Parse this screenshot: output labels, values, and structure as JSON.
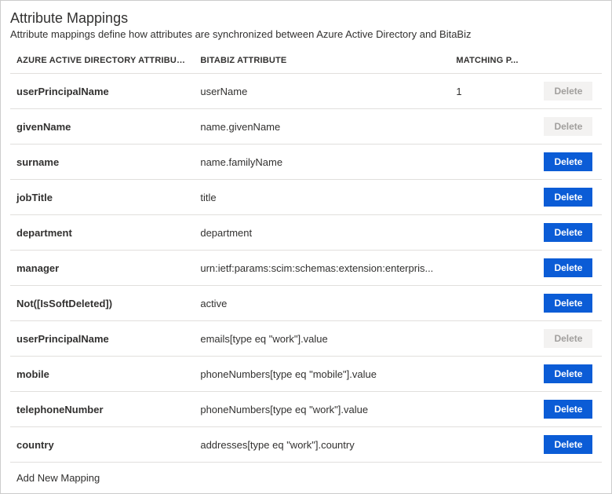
{
  "header": {
    "title": "Attribute Mappings",
    "description": "Attribute mappings define how attributes are synchronized between Azure Active Directory and BitaBiz"
  },
  "table": {
    "columns": {
      "azure": "AZURE ACTIVE DIRECTORY ATTRIBUTE",
      "target": "BITABIZ ATTRIBUTE",
      "matching": "MATCHING P...",
      "action": ""
    },
    "delete_label": "Delete",
    "rows": [
      {
        "azure": "userPrincipalName",
        "target": "userName",
        "matching": "1",
        "deletable": false
      },
      {
        "azure": "givenName",
        "target": "name.givenName",
        "matching": "",
        "deletable": false
      },
      {
        "azure": "surname",
        "target": "name.familyName",
        "matching": "",
        "deletable": true
      },
      {
        "azure": "jobTitle",
        "target": "title",
        "matching": "",
        "deletable": true
      },
      {
        "azure": "department",
        "target": "department",
        "matching": "",
        "deletable": true
      },
      {
        "azure": "manager",
        "target": "urn:ietf:params:scim:schemas:extension:enterpris...",
        "matching": "",
        "deletable": true
      },
      {
        "azure": "Not([IsSoftDeleted])",
        "target": "active",
        "matching": "",
        "deletable": true
      },
      {
        "azure": "userPrincipalName",
        "target": "emails[type eq \"work\"].value",
        "matching": "",
        "deletable": false
      },
      {
        "azure": "mobile",
        "target": "phoneNumbers[type eq \"mobile\"].value",
        "matching": "",
        "deletable": true
      },
      {
        "azure": "telephoneNumber",
        "target": "phoneNumbers[type eq \"work\"].value",
        "matching": "",
        "deletable": true
      },
      {
        "azure": "country",
        "target": "addresses[type eq \"work\"].country",
        "matching": "",
        "deletable": true
      }
    ]
  },
  "footer": {
    "add_new": "Add New Mapping"
  }
}
